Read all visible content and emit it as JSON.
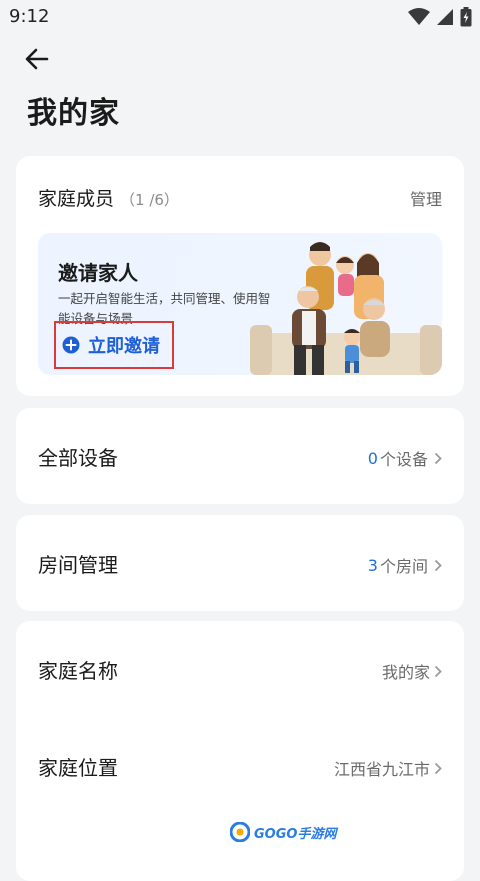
{
  "status": {
    "time": "9:12"
  },
  "header": {
    "title": "我的家"
  },
  "members": {
    "title": "家庭成员",
    "count": "（1 /6）",
    "manage": "管理",
    "invite": {
      "heading": "邀请家人",
      "description": "一起开启智能生活，共同管理、使用智能设备与场景",
      "action": "立即邀请"
    }
  },
  "devices": {
    "title": "全部设备",
    "count": "0",
    "unit": "个设备"
  },
  "rooms": {
    "title": "房间管理",
    "count": "3",
    "unit": "个房间"
  },
  "home_info": {
    "name_label": "家庭名称",
    "name_value": "我的家",
    "location_label": "家庭位置",
    "location_value": "江西省九江市"
  },
  "watermark": {
    "text": "GOGO手游网"
  },
  "colors": {
    "accent": "#1f6fe0",
    "highlight_box": "#d93b3b",
    "background": "#f3f4f6"
  }
}
